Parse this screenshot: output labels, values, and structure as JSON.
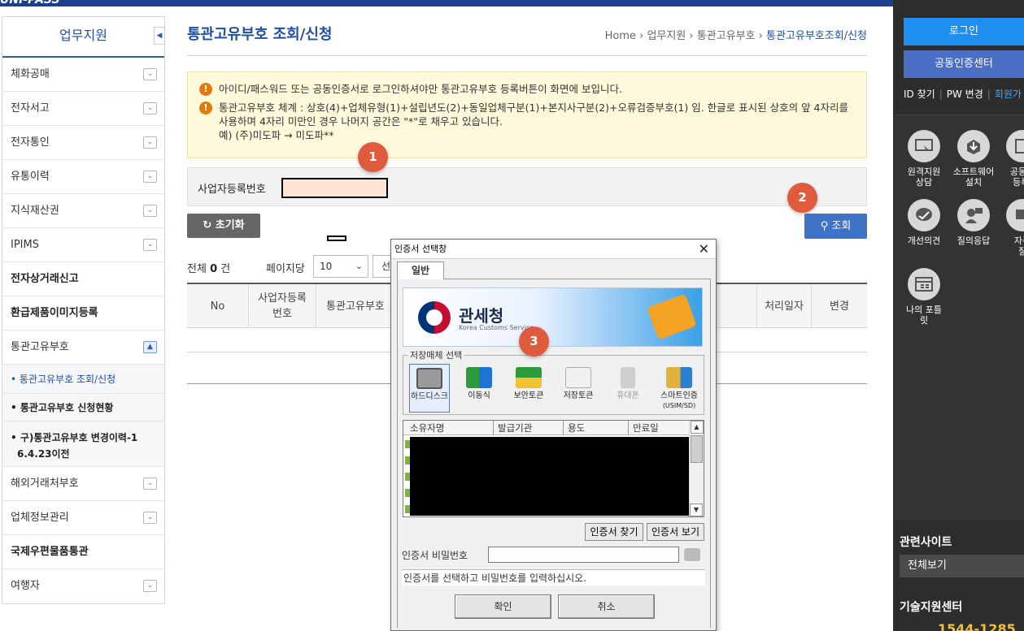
{
  "header": {
    "logo": "UNI-PASS"
  },
  "sidebar": {
    "title": "업무지원",
    "collapse_glyph": "◀",
    "items": [
      {
        "label": "체화공매"
      },
      {
        "label": "전자서고"
      },
      {
        "label": "전자통인"
      },
      {
        "label": "유통이력"
      },
      {
        "label": "지식재산권"
      },
      {
        "label": "IPIMS"
      },
      {
        "label": "전자상거래신고"
      },
      {
        "label": "환급제품이미지등록"
      },
      {
        "label": "통관고유부호"
      },
      {
        "label": "해외거래처부호"
      },
      {
        "label": "업체정보관리"
      },
      {
        "label": "국제우편물품통관"
      },
      {
        "label": "여행자"
      }
    ],
    "subitems": [
      {
        "label": "• 통관고유부호 조회/신청"
      },
      {
        "label": "• 통관고유부호 신청현황"
      },
      {
        "label": "• 구)통관고유부호 변경이력-1",
        "label2": "6.4.23이전"
      }
    ],
    "toggle_closed": "⌄",
    "toggle_open": "▲"
  },
  "main": {
    "title": "통관고유부호 조회/신청",
    "breadcrumb": [
      "Home",
      "업무지원",
      "통관고유부호",
      "통관고유부호조회/신청"
    ],
    "breadcrumb_sep": "›",
    "notices": [
      "아이디/패스워드 또는 공동인증서로 로그인하셔야만 통관고유부호 등록버튼이 화면에 보입니다.",
      "통관고유부호 체계 : 상호(4)+업체유형(1)+설립년도(2)+동일업체구분(1)+본지사구분(2)+오류검증부호(1) 임. 한글로 표시된 상호의 앞 4자리를 사용하며 4자리 미만인 경우 나머지 공간은 \"*\"로 채우고 있습니다."
    ],
    "notice_example": "예) (주)미도파 → 미도파**",
    "search_label": "사업자등록번호",
    "reset_label": "초기화",
    "search_button": "조회",
    "total_label": "전체",
    "total_count": "0",
    "total_unit": "건",
    "per_page_label": "페이지당",
    "per_page_value": "10",
    "per_page_btn": "선",
    "columns": [
      "No",
      "사업자등록\n번호",
      "통관고유부호",
      "처리일자",
      "변경"
    ]
  },
  "badges": [
    "1",
    "2",
    "3"
  ],
  "right_panel": {
    "login": "로그인",
    "cert_center": "공동인증센터",
    "id_find": "ID 찾기",
    "pw_change": "PW 변경",
    "join": "회원가",
    "quick": [
      {
        "label": "원격지원\n상담",
        "icon": "remote-support-icon"
      },
      {
        "label": "소프트웨어\n설치",
        "icon": "software-install-icon"
      },
      {
        "label": "공동인\n등록/",
        "icon": "cert-register-icon"
      },
      {
        "label": "개선의견",
        "icon": "feedback-icon"
      },
      {
        "label": "질의응답",
        "icon": "qna-icon"
      },
      {
        "label": "자주\n질",
        "icon": "faq-icon"
      },
      {
        "label": "나의 포틀\n릿",
        "icon": "portlet-icon"
      }
    ],
    "related_title": "관련사이트",
    "related_select": "전체보기",
    "tech_title": "기술지원센터",
    "tech_phone": "1544-1285"
  },
  "dialog": {
    "title": "인증서 선택창",
    "close": "✕",
    "tab": "일반",
    "banner_name": "관세청",
    "banner_en": "Korea Customs Service",
    "media_legend": "저장매체 선택",
    "media": [
      {
        "label": "하드디스크",
        "selected": true
      },
      {
        "label": "이동식",
        "selected": false
      },
      {
        "label": "보안토큰",
        "selected": false
      },
      {
        "label": "저장토큰",
        "selected": false
      },
      {
        "label": "휴대폰",
        "selected": false,
        "disabled": true
      },
      {
        "label": "스마트인증",
        "label2": "(USIM/SD)",
        "selected": false
      }
    ],
    "cert_columns": [
      "소유자명",
      "발급기관",
      "용도",
      "만료일"
    ],
    "find_cert": "인증서 찾기",
    "view_cert": "인증서 보기",
    "pw_label": "인증서 비밀번호",
    "message": "인증서를 선택하고 비밀번호를 입력하십시오.",
    "ok": "확인",
    "cancel": "취소"
  },
  "colors": {
    "brand": "#1d3f8f",
    "accent": "#3f73c8",
    "badge": "#e05a3e",
    "notice_bg": "#fff9db"
  }
}
